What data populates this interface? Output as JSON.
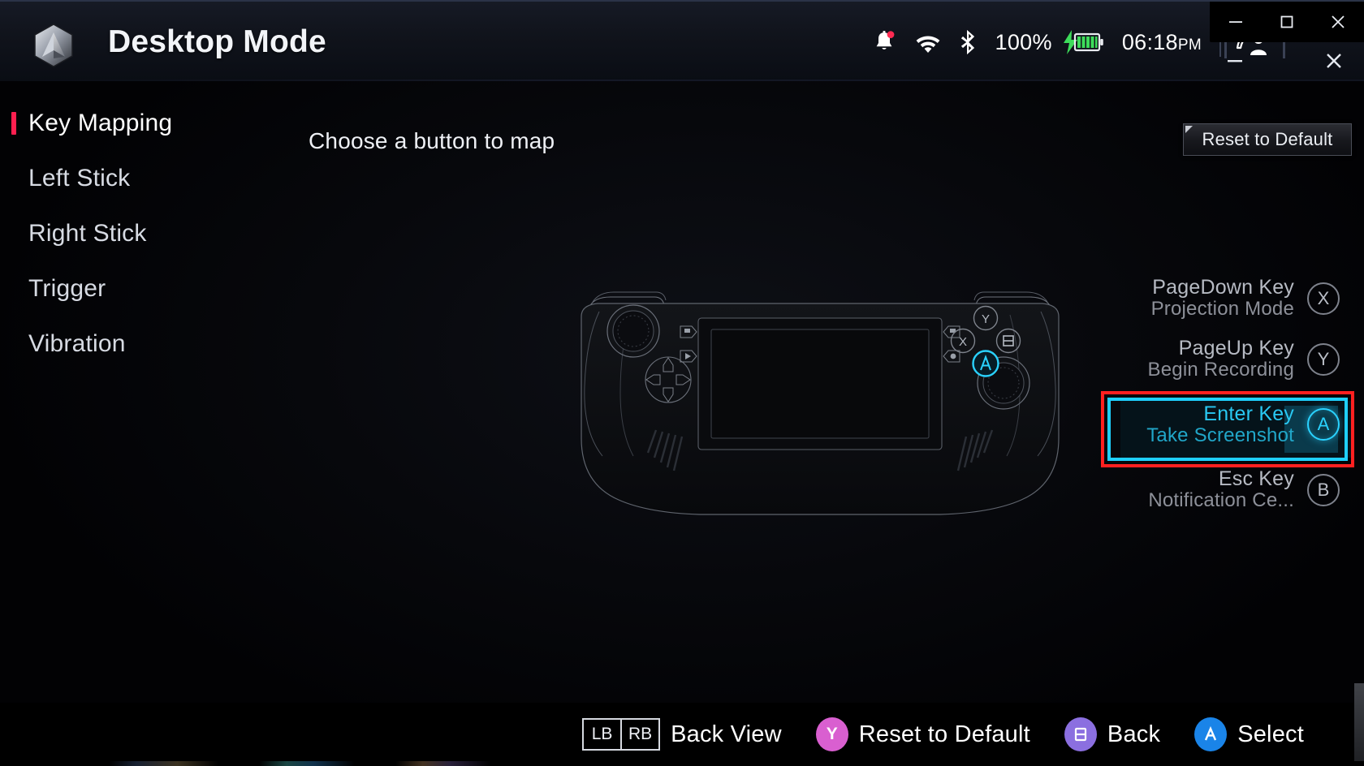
{
  "titlebar": {
    "app_title": "Desktop Mode",
    "logo_icon": "hexagon-logo-icon",
    "status": {
      "notification_icon": "bell-icon",
      "wifi_icon": "wifi-icon",
      "bluetooth_icon": "bluetooth-icon",
      "battery_percent": "100%",
      "battery_icon": "battery-charging-icon",
      "time": "06:18",
      "ampm": "PM",
      "account_icon": "guest-account-icon"
    },
    "window_controls": {
      "minimize": "minimize-icon",
      "maximize": "maximize-icon",
      "close": "close-icon"
    }
  },
  "sidebar": {
    "items": [
      {
        "label": "Key Mapping",
        "active": true
      },
      {
        "label": "Left Stick",
        "active": false
      },
      {
        "label": "Right Stick",
        "active": false
      },
      {
        "label": "Trigger",
        "active": false
      },
      {
        "label": "Vibration",
        "active": false
      }
    ]
  },
  "main": {
    "hint_text": "Choose a button to map",
    "reset_button": "Reset to Default",
    "device_illustration": "handheld-gaming-device-outline"
  },
  "mappings": [
    {
      "key": "PageDown Key",
      "action": "Projection Mode",
      "badge": "X",
      "selected": false
    },
    {
      "key": "PageUp Key",
      "action": "Begin Recording",
      "badge": "Y",
      "selected": false
    },
    {
      "key": "Enter Key",
      "action": "Take Screenshot",
      "badge": "A",
      "selected": true
    },
    {
      "key": "Esc Key",
      "action": "Notification Ce...",
      "badge": "B",
      "selected": false
    }
  ],
  "controller_buttons": {
    "y": "Y",
    "x": "X",
    "b": "B",
    "a": "A"
  },
  "footer": [
    {
      "type": "shoulder",
      "keys": [
        "LB",
        "RB"
      ],
      "label": "Back View"
    },
    {
      "type": "pad",
      "glyph": "Y",
      "label": "Reset to Default",
      "color": "#d95fd0"
    },
    {
      "type": "pad",
      "glyph": "B",
      "label": "Back",
      "color": "#8b6fe0"
    },
    {
      "type": "pad",
      "glyph": "A",
      "label": "Select",
      "color": "#1a84e8"
    }
  ],
  "colors": {
    "accent_cyan": "#2ad2ff",
    "highlight_red": "#ff2020",
    "active_marker": "#ff1f4f",
    "battery_green": "#3ddc5a"
  }
}
